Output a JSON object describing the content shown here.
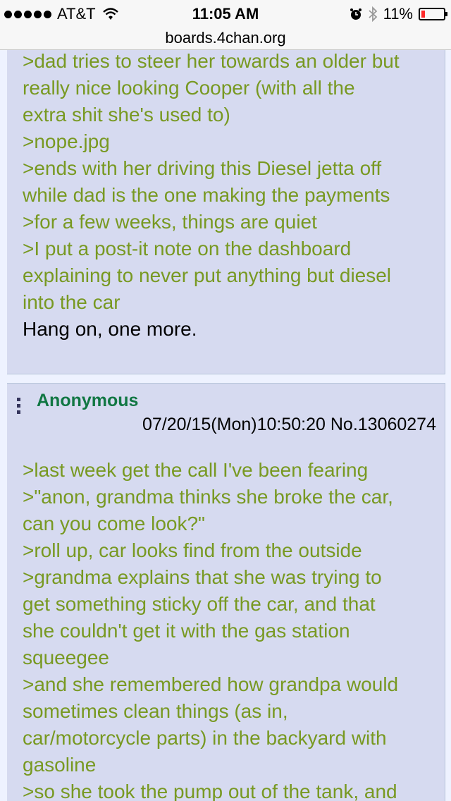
{
  "status_bar": {
    "carrier": "AT&T",
    "time": "11:05 AM",
    "battery_pct": "11%",
    "battery_level": 0.11,
    "signal_dots": 5,
    "icons": [
      "wifi-icon",
      "alarm-icon",
      "bluetooth-icon",
      "battery-icon"
    ]
  },
  "url": "boards.4chan.org",
  "colors": {
    "greentext": "#789922",
    "name": "#117743",
    "post_bg": "#d6daf0",
    "page_bg": "#eef2ff"
  },
  "post1": {
    "lines": [
      ">dad tries to steer her towards an older but",
      "really nice looking Cooper (with all the",
      "extra shit she's used to)",
      ">nope.jpg",
      ">ends with her driving this Diesel jetta off",
      "while dad is the one making the payments",
      ">for a few weeks, things are quiet",
      ">I put a post-it note on the dashboard",
      "explaining to never put anything but diesel",
      "into the car"
    ],
    "closing": "Hang on, one more."
  },
  "post2": {
    "name": "Anonymous",
    "datetime": "07/20/15(Mon)10:50:20",
    "post_no": "No.13060274",
    "lines": [
      ">last week get the call I've been fearing",
      ">\"anon, grandma thinks she broke the car,",
      "can you come look?\"",
      ">roll up, car looks find from the outside",
      ">grandma explains that she was trying to",
      "get something sticky off the car, and that",
      "she couldn't get it with the gas station",
      "squeegee",
      ">and she remembered how grandpa would",
      "sometimes clean things (as in,",
      "car/motorcycle parts) in the backyard with",
      "gasoline",
      ">so she took the pump out of the tank, and"
    ]
  }
}
